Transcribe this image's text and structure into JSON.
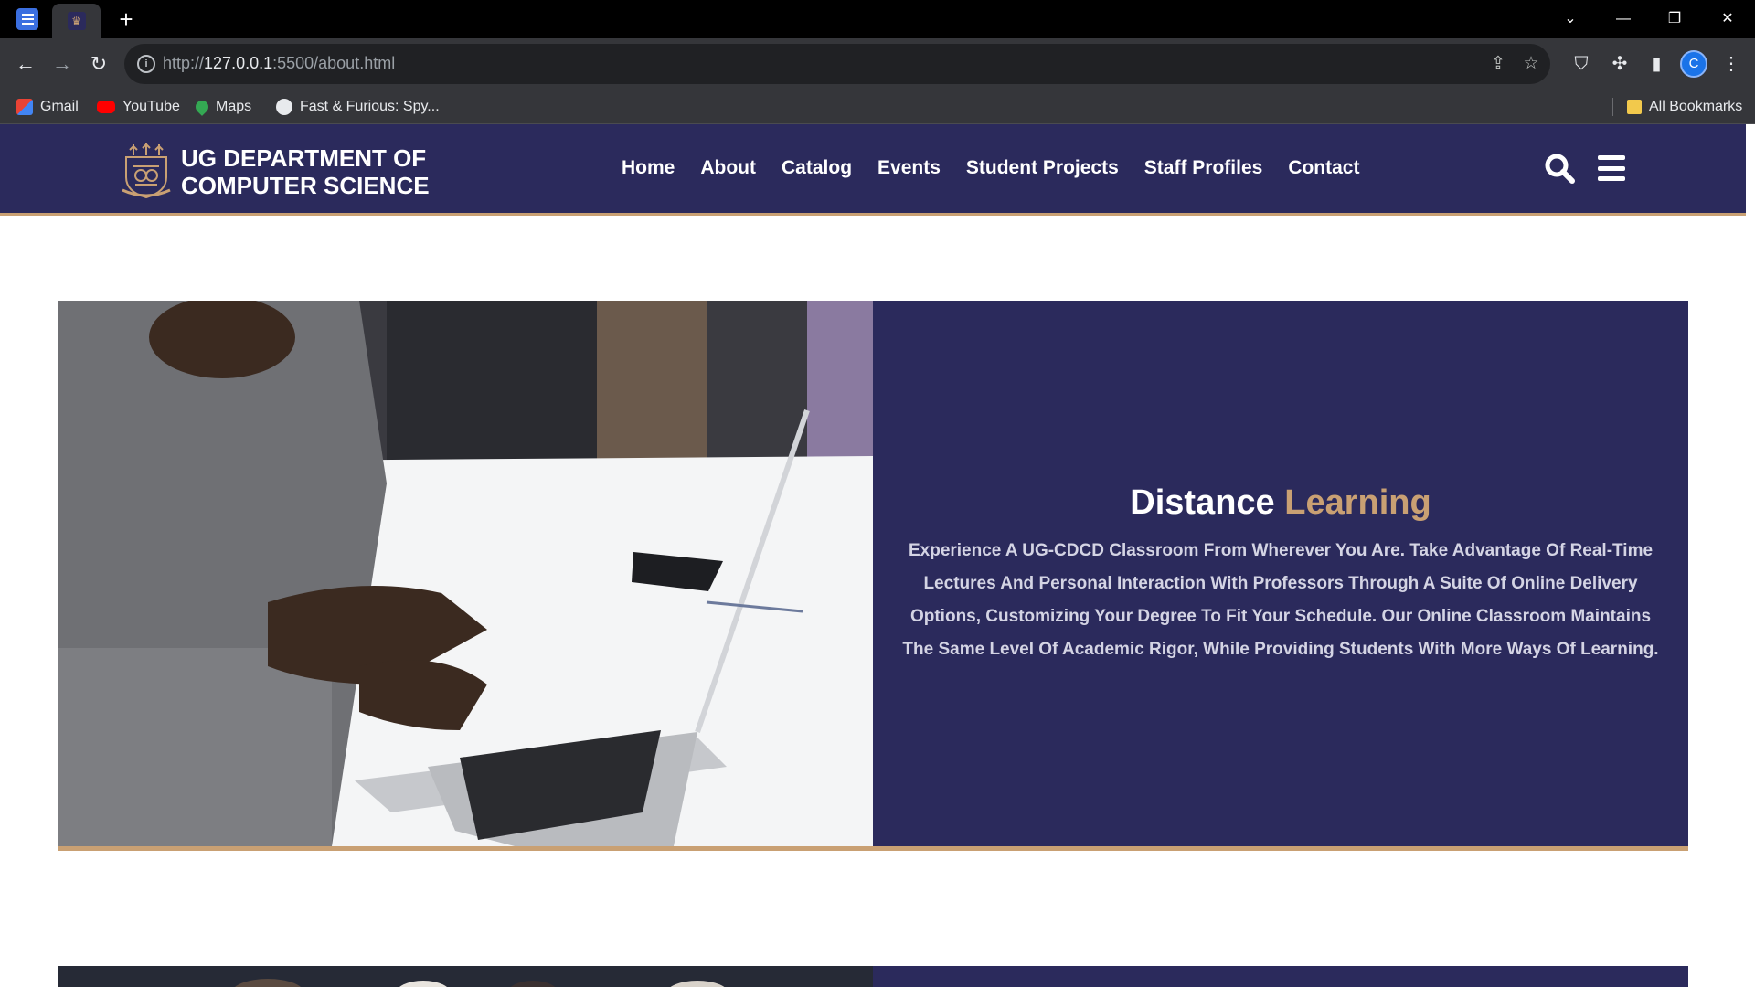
{
  "browser": {
    "new_tab_symbol": "+",
    "url": {
      "scheme": "http://",
      "host": "127.0.0.1",
      "rest": ":5500/about.html"
    },
    "bookmarks": [
      {
        "label": "Gmail",
        "icon": "gmail-icon",
        "color": "#ea4335"
      },
      {
        "label": "YouTube",
        "icon": "youtube-icon",
        "color": "#ff0000"
      },
      {
        "label": "Maps",
        "icon": "maps-icon",
        "color": "#34a853"
      },
      {
        "label": "Fast & Furious: Spy...",
        "icon": "globe-icon",
        "color": "#e8eaed"
      }
    ],
    "all_bookmarks_label": "All Bookmarks",
    "profile_initial": "C"
  },
  "site": {
    "title": "UG DEPARTMENT OF\nCOMPUTER SCIENCE",
    "nav": [
      "Home",
      "About",
      "Catalog",
      "Events",
      "Student Projects",
      "Staff Profiles",
      "Contact"
    ]
  },
  "feature": {
    "heading_part1": "Distance",
    "heading_part2": "Learning",
    "body": "Experience A UG-CDCD Classroom From Wherever You Are. Take Advantage Of Real-Time Lectures And Personal Interaction With Professors Through A Suite Of Online Delivery Options, Customizing Your Degree To Fit Your Schedule. Our Online Classroom Maintains The Same Level Of Academic Rigor, While Providing Students With More Ways Of Learning."
  },
  "colors": {
    "brand_navy": "#2b2a5c",
    "brand_gold": "#c9a073",
    "chrome_dark": "#35363a"
  }
}
